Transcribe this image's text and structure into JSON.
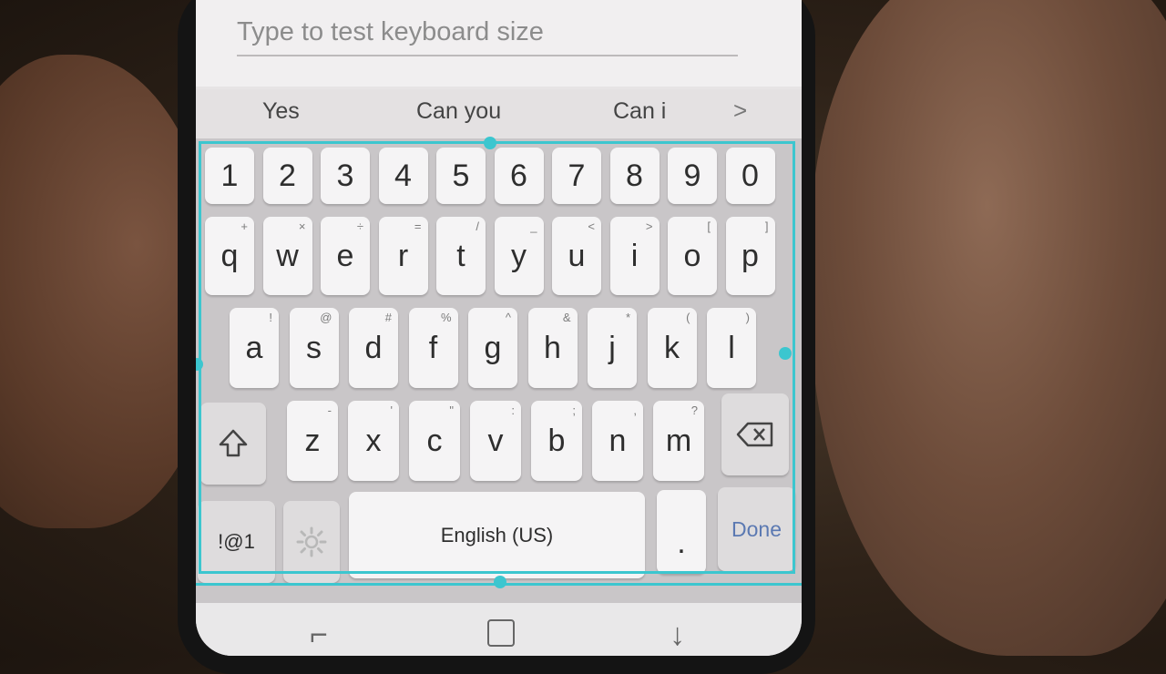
{
  "text_field": {
    "placeholder": "Type to test keyboard size",
    "value": ""
  },
  "suggestions": [
    "Yes",
    "Can you",
    "Can i"
  ],
  "suggestion_more": ">",
  "rows": {
    "numbers": [
      "1",
      "2",
      "3",
      "4",
      "5",
      "6",
      "7",
      "8",
      "9",
      "0"
    ],
    "top": [
      {
        "k": "q",
        "s": "+"
      },
      {
        "k": "w",
        "s": "×"
      },
      {
        "k": "e",
        "s": "÷"
      },
      {
        "k": "r",
        "s": "="
      },
      {
        "k": "t",
        "s": "/"
      },
      {
        "k": "y",
        "s": "_"
      },
      {
        "k": "u",
        "s": "<"
      },
      {
        "k": "i",
        "s": ">"
      },
      {
        "k": "o",
        "s": "["
      },
      {
        "k": "p",
        "s": "]"
      }
    ],
    "middle": [
      {
        "k": "a",
        "s": "!"
      },
      {
        "k": "s",
        "s": "@"
      },
      {
        "k": "d",
        "s": "#"
      },
      {
        "k": "f",
        "s": "%"
      },
      {
        "k": "g",
        "s": "^"
      },
      {
        "k": "h",
        "s": "&"
      },
      {
        "k": "j",
        "s": "*"
      },
      {
        "k": "k",
        "s": "("
      },
      {
        "k": "l",
        "s": ")"
      }
    ],
    "bottom": [
      {
        "k": "z",
        "s": "-"
      },
      {
        "k": "x",
        "s": "'"
      },
      {
        "k": "c",
        "s": "\""
      },
      {
        "k": "v",
        "s": ":"
      },
      {
        "k": "b",
        "s": ";"
      },
      {
        "k": "n",
        "s": ","
      },
      {
        "k": "m",
        "s": "?"
      }
    ]
  },
  "keys": {
    "symbols": "!@1",
    "space": "English (US)",
    "period": ".",
    "done": "Done"
  },
  "icons": {
    "shift": "shift-icon",
    "backspace": "backspace-icon",
    "settings": "gear-icon"
  },
  "colors": {
    "resize_frame": "#3cc6cf",
    "done_label": "#5b79b2"
  }
}
